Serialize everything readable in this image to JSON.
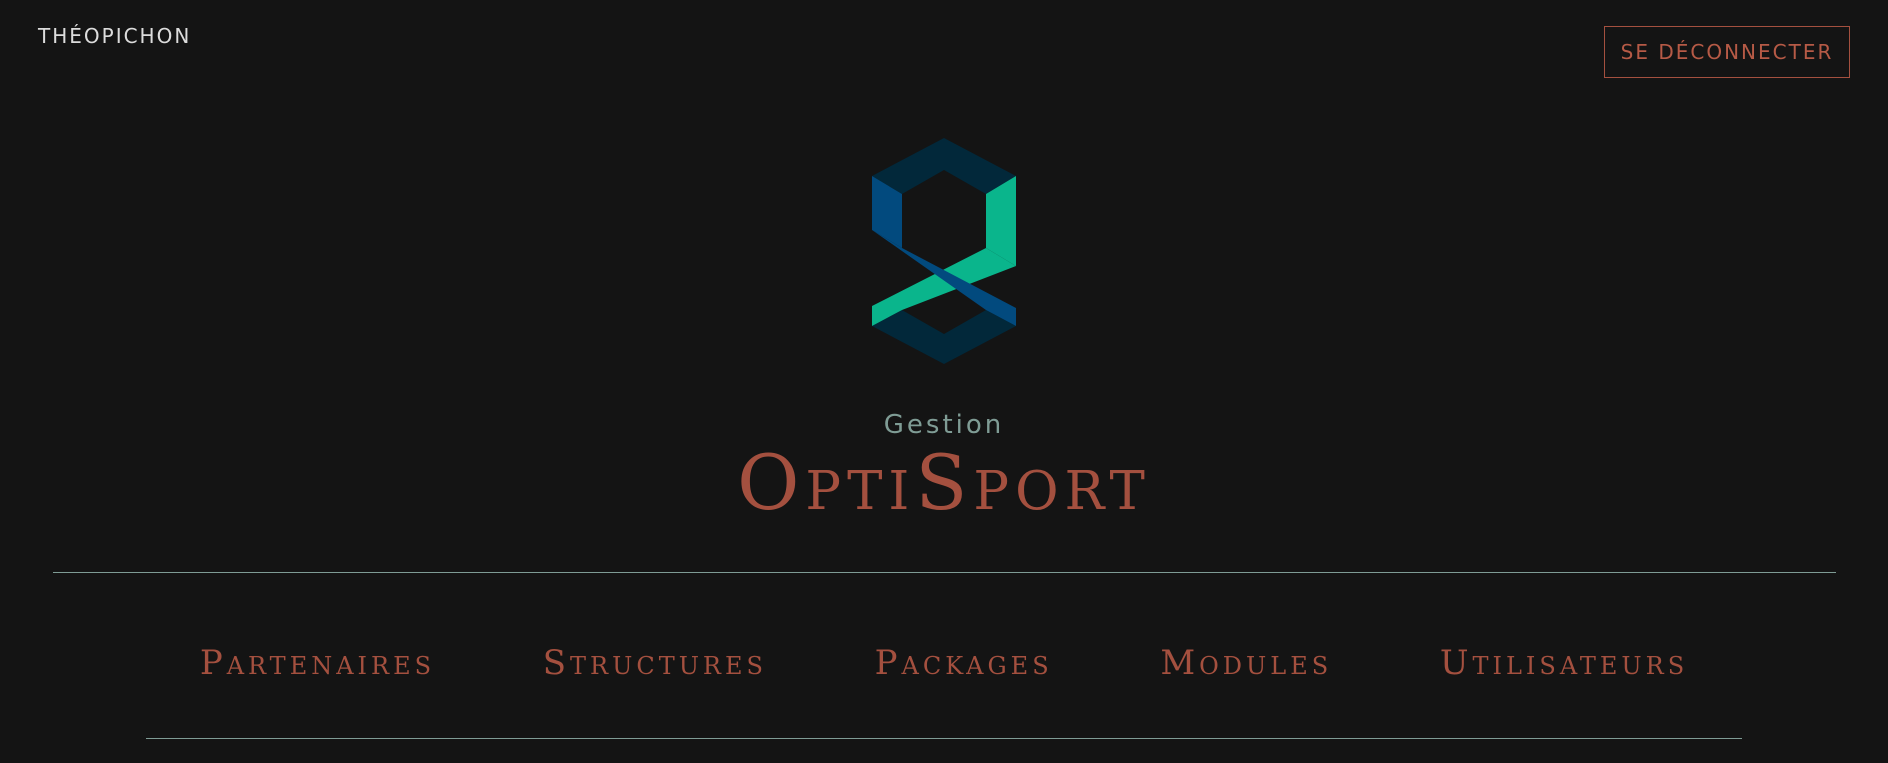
{
  "header": {
    "username": "THÉOPICHON",
    "logout_label": "SE DÉCONNECTER"
  },
  "brand": {
    "logo_icon": "optisport-ribbon-logo-icon",
    "subtitle": "Gestion",
    "title": "OptiSport"
  },
  "nav": {
    "items": [
      {
        "label": "Partenaires"
      },
      {
        "label": "Structures"
      },
      {
        "label": "Packages"
      },
      {
        "label": "Modules"
      },
      {
        "label": "Utilisateurs"
      }
    ]
  },
  "colors": {
    "background": "#141414",
    "accent": "#a4503f",
    "muted": "#7f9c95",
    "logo_blue": "#024a7e",
    "logo_green": "#0ab58c",
    "logo_dark": "#02283a"
  }
}
